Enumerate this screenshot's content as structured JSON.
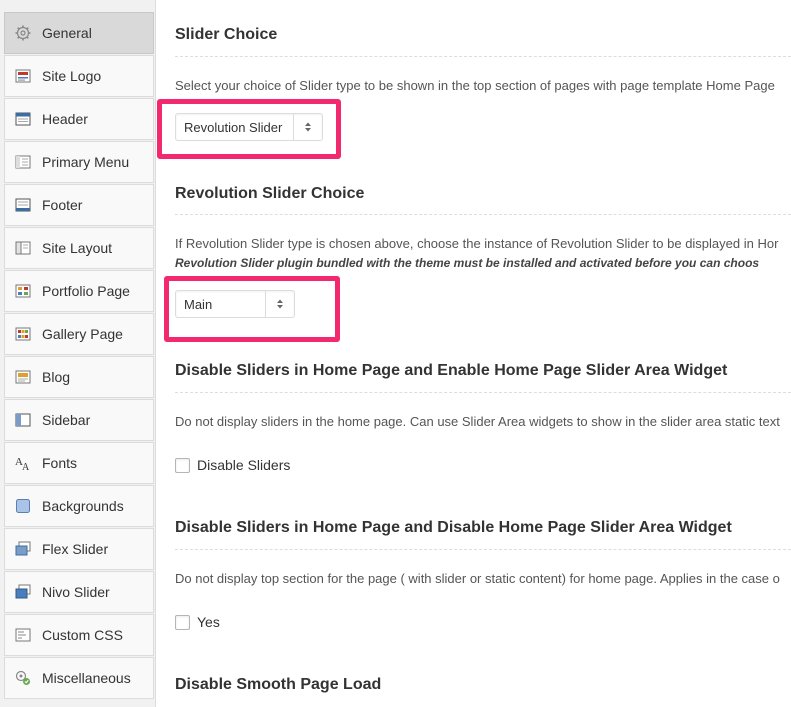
{
  "sidebar": {
    "items": [
      {
        "label": "General",
        "icon": "gear-icon",
        "active": true
      },
      {
        "label": "Site Logo",
        "icon": "logo-icon"
      },
      {
        "label": "Header",
        "icon": "header-icon"
      },
      {
        "label": "Primary Menu",
        "icon": "menu-icon"
      },
      {
        "label": "Footer",
        "icon": "footer-icon"
      },
      {
        "label": "Site Layout",
        "icon": "layout-icon"
      },
      {
        "label": "Portfolio Page",
        "icon": "portfolio-icon"
      },
      {
        "label": "Gallery Page",
        "icon": "gallery-icon"
      },
      {
        "label": "Blog",
        "icon": "blog-icon"
      },
      {
        "label": "Sidebar",
        "icon": "sidebar-icon"
      },
      {
        "label": "Fonts",
        "icon": "fonts-icon"
      },
      {
        "label": "Backgrounds",
        "icon": "backgrounds-icon"
      },
      {
        "label": "Flex Slider",
        "icon": "flex-slider-icon"
      },
      {
        "label": "Nivo Slider",
        "icon": "nivo-slider-icon"
      },
      {
        "label": "Custom CSS",
        "icon": "custom-css-icon"
      },
      {
        "label": "Miscellaneous",
        "icon": "miscellaneous-icon"
      }
    ]
  },
  "sections": {
    "slider_choice": {
      "title": "Slider Choice",
      "description": "Select your choice of Slider type to be shown in the top section of pages with page template Home Page",
      "value": "Revolution Slider"
    },
    "revolution_slider_choice": {
      "title": "Revolution Slider Choice",
      "description": "If Revolution Slider type is chosen above, choose the instance of Revolution Slider to be displayed in Hor",
      "note": "Revolution Slider plugin bundled with the theme must be installed and activated before you can choos",
      "value": "Main"
    },
    "disable_sliders_enable_widget": {
      "title": "Disable Sliders in Home Page and Enable Home Page Slider Area Widget",
      "description": "Do not display sliders in the home page. Can use Slider Area widgets to show in the slider area static text",
      "checkbox_label": "Disable Sliders",
      "checked": false
    },
    "disable_sliders_disable_widget": {
      "title": "Disable Sliders in Home Page and Disable Home Page Slider Area Widget",
      "description": "Do not display top section for the page ( with slider or static content) for home page. Applies in the case o",
      "checkbox_label": "Yes",
      "checked": false
    },
    "disable_smooth_load": {
      "title": "Disable Smooth Page Load"
    }
  },
  "colors": {
    "highlight": "#f2296f",
    "active_nav": "#d9d9d9"
  }
}
